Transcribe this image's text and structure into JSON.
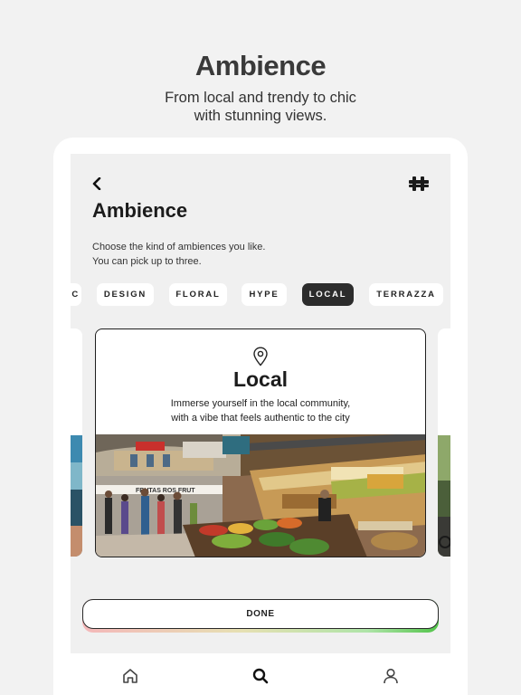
{
  "hero": {
    "title": "Ambience",
    "subtitle_line1": "From local and trendy to chic",
    "subtitle_line2": "with stunning views."
  },
  "screen": {
    "back_icon": "chevron-left-icon",
    "logo_icon": "puzzle-logo-icon",
    "title": "Ambience",
    "instruction_line1": "Choose the kind of ambiences you like.",
    "instruction_line2": "You can pick up to three."
  },
  "chips": [
    {
      "label": "C",
      "selected": false
    },
    {
      "label": "DESIGN",
      "selected": false
    },
    {
      "label": "FLORAL",
      "selected": false
    },
    {
      "label": "HYPE",
      "selected": false
    },
    {
      "label": "LOCAL",
      "selected": true
    },
    {
      "label": "TERRAZZA",
      "selected": false
    }
  ],
  "card": {
    "icon": "location-pin-icon",
    "title": "Local",
    "desc_line1": "Immerse yourself in the local community,",
    "desc_line2": "with a vibe that feels authentic to the city",
    "photo_signs": [
      "FRUTAS ROS FRUT"
    ]
  },
  "done_label": "DONE",
  "nav": [
    {
      "icon": "home-icon"
    },
    {
      "icon": "search-icon"
    },
    {
      "icon": "profile-icon"
    }
  ],
  "colors": {
    "page_background": "#f2f2f2",
    "screen_background": "#f0f0f0",
    "selected_chip": "#2c2c2c",
    "done_gradient_end": "#52c44a"
  }
}
